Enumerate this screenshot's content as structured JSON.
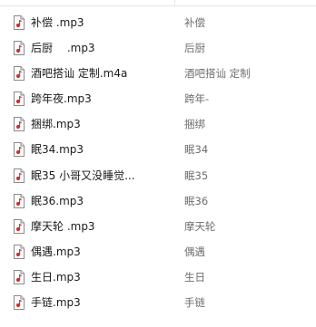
{
  "file_list": {
    "columns": {
      "name": "",
      "title": ""
    },
    "icon": "music-file-icon",
    "accent_color": "#c8332b",
    "rows": [
      {
        "name": "补偿 .mp3",
        "title": "补偿"
      },
      {
        "name": "后厨 　.mp3",
        "title": "后厨"
      },
      {
        "name": "酒吧搭讪 定制.m4a",
        "title": "酒吧搭讪 定制"
      },
      {
        "name": "跨年夜.mp3",
        "title": "跨年-"
      },
      {
        "name": "捆绑.mp3",
        "title": "捆绑"
      },
      {
        "name": "眠34.mp3",
        "title": "眠34"
      },
      {
        "name": "眠35 小哥又没睡觉...",
        "title": "眠35"
      },
      {
        "name": "眠36.mp3",
        "title": "眠36"
      },
      {
        "name": "摩天轮 .mp3",
        "title": "摩天轮"
      },
      {
        "name": "偶遇.mp3",
        "title": "偶遇"
      },
      {
        "name": "生日.mp3",
        "title": "生日"
      },
      {
        "name": "手链.mp3",
        "title": "手链"
      }
    ]
  }
}
